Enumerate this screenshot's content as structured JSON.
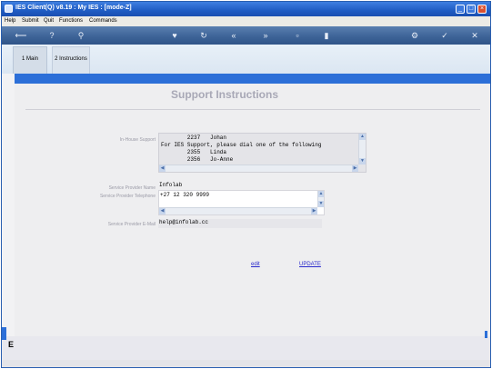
{
  "window": {
    "title": "IES Client(Q) v8.19 : My IES :     [mode-Z]",
    "min_glyph": "_",
    "max_glyph": "□",
    "close_glyph": "×"
  },
  "menu": [
    "Help",
    "Submit",
    "Quit",
    "Functions",
    "Commands"
  ],
  "toolbar": {
    "icons": [
      "back-arrow-icon",
      "help-icon",
      "search-icon",
      "heart-icon",
      "refresh-icon",
      "rewind-icon",
      "fast-forward-icon",
      "stop-icon",
      "page-icon",
      "settings-icon",
      "check-icon",
      "close-icon"
    ]
  },
  "tabs": [
    {
      "label": "1 Main"
    },
    {
      "label": "2 Instructions"
    }
  ],
  "page": {
    "heading": "Support Instructions"
  },
  "fields": {
    "in_house_label": "In-House Support",
    "in_house_lines": [
      "        2237   Johan",
      "For IES Support, please dial one of the following",
      "        2355   Linda",
      "        2356   Jo-Anne"
    ],
    "provider_name_label": "Service Provider Name",
    "provider_name_value": "Infolab",
    "provider_phone_label": "Service Provider Telephone",
    "provider_phone_value": "+27 12 320 9999",
    "provider_email_label": "Service Provider E-Mail",
    "provider_email_value": "help@infolab.cc"
  },
  "actions": {
    "edit": "edit",
    "update": "UPDATE"
  },
  "sidebar_glyph": "E",
  "colors": {
    "title_blue": "#1f5cc4",
    "accent_blue": "#2c6fd8",
    "toolbar_blue": "#3e6498",
    "link_blue": "#2a2acc"
  }
}
